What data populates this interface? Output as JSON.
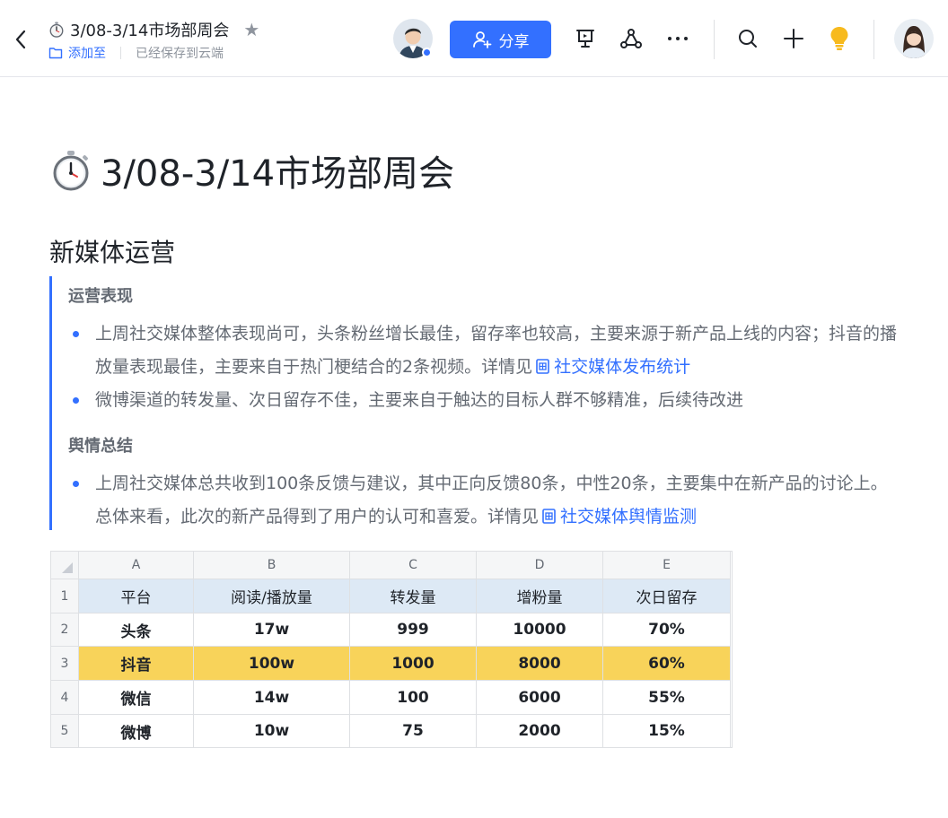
{
  "header": {
    "title": "3/08-3/14市场部周会",
    "add_to": "添加至",
    "saved_status": "已经保存到云端",
    "share_label": "分享",
    "icons": [
      "back-icon",
      "stopwatch-icon",
      "star-icon",
      "folder-icon",
      "presentation-icon",
      "share-network-icon",
      "more-icon",
      "search-icon",
      "plus-icon",
      "lightbulb-icon"
    ],
    "colors": {
      "accent": "#3370ff",
      "bulb": "#f7ba1e"
    }
  },
  "doc": {
    "title": "3/08-3/14市场部周会",
    "section_title": "新媒体运营",
    "blocks": {
      "performance_title": "运营表现",
      "bullet1_text": "上周社交媒体整体表现尚可，头条粉丝增长最佳，留存率也较高，主要来源于新产品上线的内容；抖音的播放量表现最佳，主要来自于热门梗结合的2条视频。详情见",
      "bullet1_link": "社交媒体发布统计",
      "bullet2_text": "微博渠道的转发量、次日留存不佳，主要来自于触达的目标人群不够精准，后续待改进",
      "sentiment_title": "舆情总结",
      "bullet3_text": "上周社交媒体总共收到100条反馈与建议，其中正向反馈80条，中性20条，主要集中在新产品的讨论上。总体来看，此次的新产品得到了用户的认可和喜爱。详情见",
      "bullet3_link": "社交媒体舆情监测"
    }
  },
  "sheet": {
    "columns": [
      "A",
      "B",
      "C",
      "D",
      "E"
    ],
    "row_numbers": [
      "1",
      "2",
      "3",
      "4",
      "5"
    ],
    "rows": [
      [
        "平台",
        "阅读/播放量",
        "转发量",
        "增粉量",
        "次日留存"
      ],
      [
        "头条",
        "17w",
        "999",
        "10000",
        "70%"
      ],
      [
        "抖音",
        "100w",
        "1000",
        "8000",
        "60%"
      ],
      [
        "微信",
        "14w",
        "100",
        "6000",
        "55%"
      ],
      [
        "微博",
        "10w",
        "75",
        "2000",
        "15%"
      ]
    ],
    "header_row_color": "#dde9f5",
    "highlight_row_color": "#f8d35a"
  }
}
